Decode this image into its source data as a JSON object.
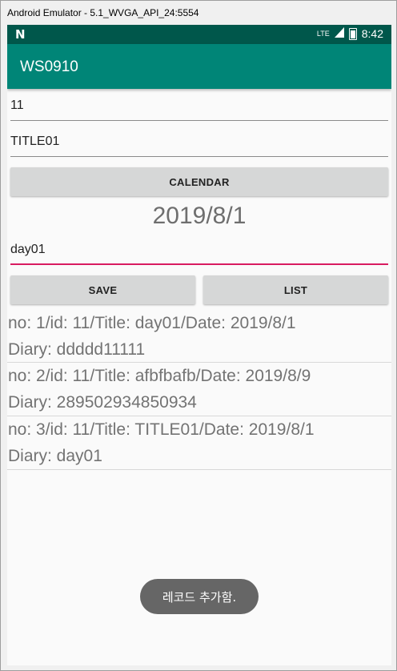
{
  "window": {
    "title": "Android Emulator - 5.1_WVGA_API_24:5554"
  },
  "statusbar": {
    "left_icon": "N",
    "network": "LTE",
    "time": "8:42"
  },
  "appbar": {
    "title": "WS0910"
  },
  "form": {
    "id_value": "11",
    "title_value": "TITLE01",
    "calendar_label": "CALENDAR",
    "date": "2019/8/1",
    "diary_value": "day01",
    "save_label": "SAVE",
    "list_label": "LIST"
  },
  "records": [
    {
      "line1": "no: 1/id: 11/Title: day01/Date: 2019/8/1",
      "line2": "Diary: ddddd11111"
    },
    {
      "line1": "no: 2/id: 11/Title: afbfbafb/Date: 2019/8/9",
      "line2": "Diary: 289502934850934"
    },
    {
      "line1": "no: 3/id: 11/Title: TITLE01/Date: 2019/8/1",
      "line2": "Diary: day01"
    }
  ],
  "toast": {
    "text": "레코드 추가함."
  }
}
